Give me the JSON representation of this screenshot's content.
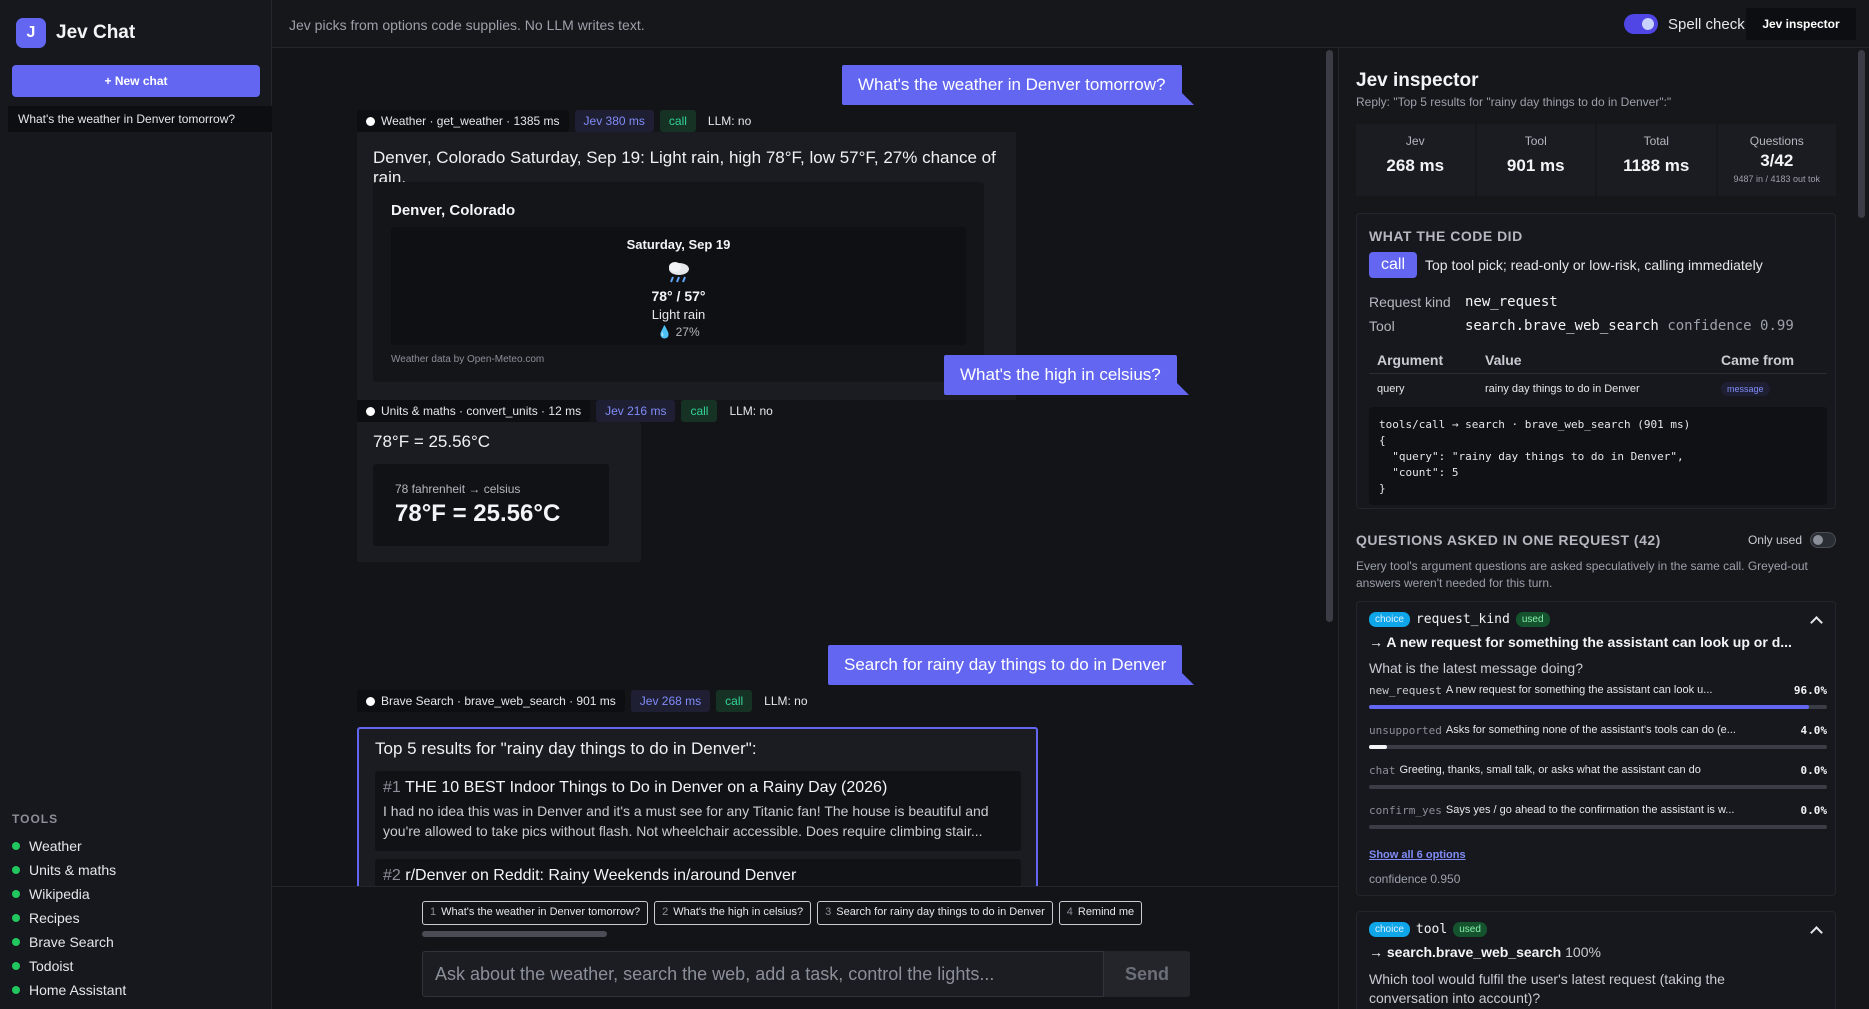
{
  "app": {
    "logo_letter": "J",
    "name": "Jev Chat"
  },
  "sidebar": {
    "new_chat_label": "+ New chat",
    "chats": [
      "What's the weather in Denver tomorrow?"
    ],
    "tools_title": "TOOLS",
    "tools": [
      "Weather",
      "Units & maths",
      "Wikipedia",
      "Recipes",
      "Brave Search",
      "Todoist",
      "Home Assistant"
    ]
  },
  "topbar": {
    "note": "Jev picks from options code supplies. No LLM writes text.",
    "spell_check_label": "Spell check",
    "spell_check_on": true,
    "inspector_label": "Jev inspector"
  },
  "messages": [
    {
      "user": "What's the weather in Denver tomorrow?",
      "meta": {
        "tool": "Weather · get_weather · 1385 ms",
        "jev": "Jev 380 ms",
        "decision": "call",
        "llm": "LLM: no"
      },
      "reply": "Denver, Colorado Saturday, Sep 19: Light rain, high 78°F, low 57°F, 27% chance of rain.",
      "weather": {
        "location": "Denver, Colorado",
        "day": "Saturday, Sep 19",
        "icon": "rain-cloud-icon",
        "temps": "78° / 57°",
        "desc": "Light rain",
        "rain": "💧 27%",
        "credit": "Weather data by Open-Meteo.com"
      }
    },
    {
      "user": "What's the high in celsius?",
      "meta": {
        "tool": "Units & maths · convert_units · 12 ms",
        "jev": "Jev 216 ms",
        "decision": "call",
        "llm": "LLM: no"
      },
      "reply": "78°F = 25.56°C",
      "conversion": {
        "query": "78 fahrenheit → celsius",
        "result": "78°F = 25.56°C"
      }
    },
    {
      "user": "Search for rainy day things to do in Denver",
      "meta": {
        "tool": "Brave Search · brave_web_search · 901 ms",
        "jev": "Jev 268 ms",
        "decision": "call",
        "llm": "LLM: no"
      },
      "reply": "Top 5 results for \"rainy day things to do in Denver\":",
      "results": [
        {
          "num": "#1",
          "title": "THE 10 BEST Indoor Things to Do in Denver on a Rainy Day (2026)",
          "snippet": "I had no idea this was in Denver and it's a must see for any Titanic fan! The house is beautiful and you're allowed to take pics without flash. Not wheelchair accessible. Does require climbing stair..."
        },
        {
          "num": "#2",
          "title": "r/Denver on Reddit: Rainy Weekends in/around Denver",
          "snippet": ""
        }
      ]
    }
  ],
  "composer": {
    "suggestions": [
      {
        "n": "1",
        "text": "What's the weather in Denver tomorrow?"
      },
      {
        "n": "2",
        "text": "What's the high in celsius?"
      },
      {
        "n": "3",
        "text": "Search for rainy day things to do in Denver"
      },
      {
        "n": "4",
        "text": "Remind me"
      }
    ],
    "placeholder": "Ask about the weather, search the web, add a task, control the lights...",
    "send_label": "Send"
  },
  "inspector": {
    "title": "Jev inspector",
    "reply": "Reply: \"Top 5 results for \"rainy day things to do in Denver\":\"",
    "stats": [
      {
        "label": "Jev",
        "value": "268 ms",
        "sub": ""
      },
      {
        "label": "Tool",
        "value": "901 ms",
        "sub": ""
      },
      {
        "label": "Total",
        "value": "1188 ms",
        "sub": ""
      },
      {
        "label": "Questions",
        "value": "3/42",
        "sub": "9487 in / 4183 out tok"
      }
    ],
    "code_did": {
      "title": "WHAT THE CODE DID",
      "badge": "call",
      "summary": "Top tool pick; read-only or low-risk, calling immediately",
      "request_kind_label": "Request kind",
      "request_kind": "new_request",
      "tool_label": "Tool",
      "tool": "search.brave_web_search",
      "confidence": "confidence 0.99",
      "arg_headers": [
        "Argument",
        "Value",
        "Came from"
      ],
      "args": [
        {
          "name": "query",
          "value": "rainy day things to do in Denver",
          "source": "message"
        }
      ],
      "code": "tools/call → search · brave_web_search (901 ms)\n{\n  \"query\": \"rainy day things to do in Denver\",\n  \"count\": 5\n}"
    },
    "questions": {
      "title": "QUESTIONS ASKED IN ONE REQUEST (42)",
      "only_used_label": "Only used",
      "only_used_on": false,
      "desc": "Every tool's argument questions are asked speculatively in the same call. Greyed-out answers weren't needed for this turn.",
      "cards": [
        {
          "type": "choice",
          "key": "request_kind",
          "status": "used",
          "answer": "→ A new request for something the assistant can look up or d...",
          "question": "What is the latest message doing?",
          "options": [
            {
              "key": "new_request",
              "desc": "A new request for something the assistant can look u...",
              "pct": "96.0%",
              "fraction": 0.96,
              "chosen": true
            },
            {
              "key": "unsupported",
              "desc": "Asks for something none of the assistant's tools can do (e...",
              "pct": "4.0%",
              "fraction": 0.04,
              "chosen": false
            },
            {
              "key": "chat",
              "desc": "Greeting, thanks, small talk, or asks what the assistant can do",
              "pct": "0.0%",
              "fraction": 0.0,
              "chosen": false
            },
            {
              "key": "confirm_yes",
              "desc": "Says yes / go ahead to the confirmation the assistant is w...",
              "pct": "0.0%",
              "fraction": 0.0,
              "chosen": false
            }
          ],
          "show_all": "Show all 6 options",
          "confidence": "confidence 0.950"
        },
        {
          "type": "choice",
          "key": "tool",
          "status": "used",
          "answer": "→ search.brave_web_search",
          "answer_pct": "100%",
          "question": "Which tool would fulfil the user's latest request (taking the conversation into account)?"
        }
      ]
    }
  }
}
